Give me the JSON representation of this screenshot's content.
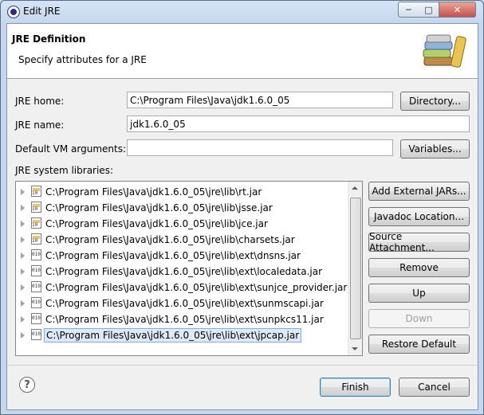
{
  "window": {
    "title": "Edit JRE",
    "controls": {
      "minimize": "─",
      "maximize": "□",
      "close": "✕"
    }
  },
  "header": {
    "title": "JRE Definition",
    "subtitle": "Specify attributes for a JRE",
    "icon": "library-books-icon"
  },
  "form": {
    "jre_home_label": "JRE home:",
    "jre_home_value": "C:\\Program Files\\Java\\jdk1.6.0_05",
    "directory_button": "Directory...",
    "jre_name_label": "JRE name:",
    "jre_name_value": "jdk1.6.0_05",
    "vm_args_label": "Default VM arguments:",
    "vm_args_value": "",
    "variables_button": "Variables...",
    "libraries_label": "JRE system libraries:"
  },
  "libraries": [
    {
      "path": "C:\\Program Files\\Java\\jdk1.6.0_05\\jre\\lib\\rt.jar",
      "icon": "jar-icon"
    },
    {
      "path": "C:\\Program Files\\Java\\jdk1.6.0_05\\jre\\lib\\jsse.jar",
      "icon": "jar-icon"
    },
    {
      "path": "C:\\Program Files\\Java\\jdk1.6.0_05\\jre\\lib\\jce.jar",
      "icon": "jar-icon"
    },
    {
      "path": "C:\\Program Files\\Java\\jdk1.6.0_05\\jre\\lib\\charsets.jar",
      "icon": "jar-icon"
    },
    {
      "path": "C:\\Program Files\\Java\\jdk1.6.0_05\\jre\\lib\\ext\\dnsns.jar",
      "icon": "binary-jar-icon"
    },
    {
      "path": "C:\\Program Files\\Java\\jdk1.6.0_05\\jre\\lib\\ext\\localedata.jar",
      "icon": "binary-jar-icon"
    },
    {
      "path": "C:\\Program Files\\Java\\jdk1.6.0_05\\jre\\lib\\ext\\sunjce_provider.jar",
      "icon": "binary-jar-icon"
    },
    {
      "path": "C:\\Program Files\\Java\\jdk1.6.0_05\\jre\\lib\\ext\\sunmscapi.jar",
      "icon": "binary-jar-icon"
    },
    {
      "path": "C:\\Program Files\\Java\\jdk1.6.0_05\\jre\\lib\\ext\\sunpkcs11.jar",
      "icon": "binary-jar-icon"
    },
    {
      "path": "C:\\Program Files\\Java\\jdk1.6.0_05\\jre\\lib\\ext\\jpcap.jar",
      "icon": "binary-jar-icon",
      "selected": true
    }
  ],
  "side_buttons": {
    "add_external_jars": "Add External JARs...",
    "javadoc_location": "Javadoc Location...",
    "source_attachment": "Source Attachment...",
    "remove": "Remove",
    "up": "Up",
    "down": "Down",
    "restore_default": "Restore Default"
  },
  "footer": {
    "help": "?",
    "finish": "Finish",
    "cancel": "Cancel"
  },
  "colors": {
    "selection_bg": "#dde9f8",
    "selection_border": "#84acdd",
    "default_button_border": "#3c7fb1"
  }
}
